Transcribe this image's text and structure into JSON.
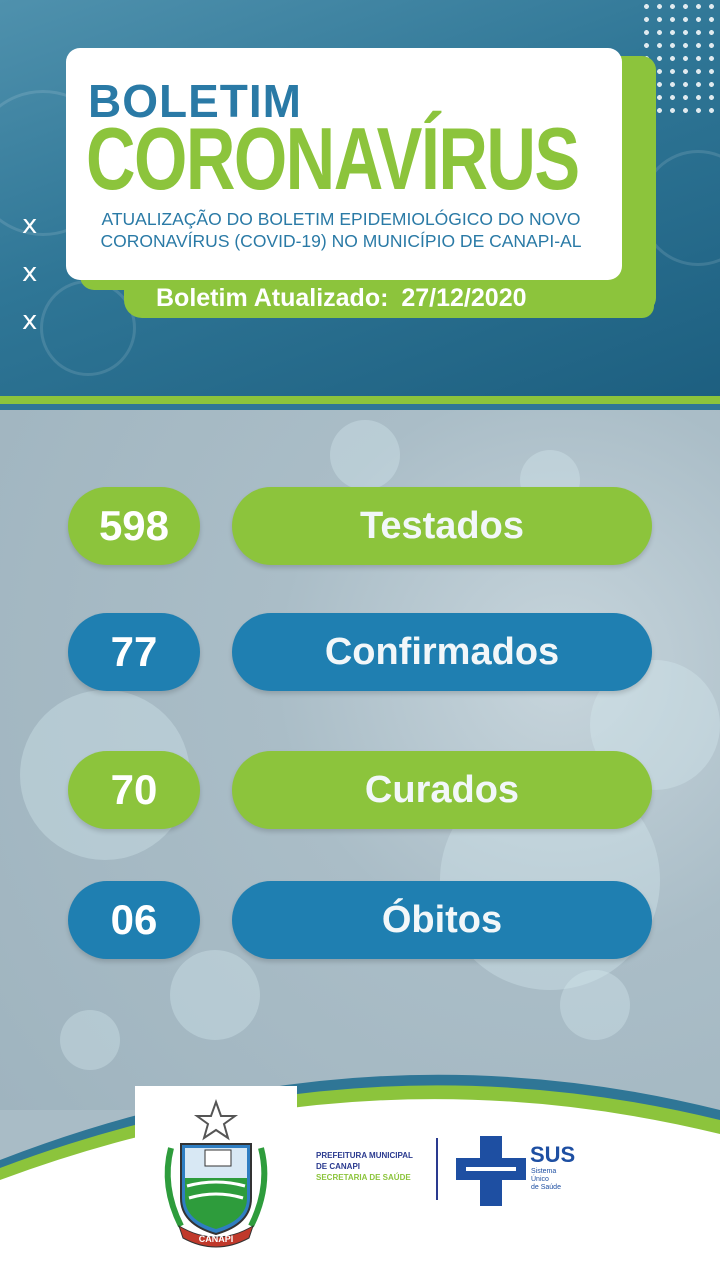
{
  "header": {
    "title_line1": "BOLETIM",
    "title_line2": "CORONAVÍRUS",
    "subtitle_line1": "ATUALIZAÇÃO DO BOLETIM EPIDEMIOLÓGICO DO NOVO",
    "subtitle_line2": "CORONAVÍRUS (COVID-19) NO MUNICÍPIO DE CANAPI-AL",
    "updated_label": "Boletim Atualizado:",
    "updated_date": "27/12/2020",
    "side_marks": [
      "x",
      "x",
      "x"
    ]
  },
  "stats": [
    {
      "value": "598",
      "label": "Testados",
      "color": "green"
    },
    {
      "value": "77",
      "label": "Confirmados",
      "color": "blue"
    },
    {
      "value": "70",
      "label": "Curados",
      "color": "green"
    },
    {
      "value": "06",
      "label": "Óbitos",
      "color": "blue"
    }
  ],
  "footer": {
    "crest_text": "CANAPI",
    "prefeitura_line1": "PREFEITURA MUNICIPAL",
    "prefeitura_line2": "DE CANAPI",
    "secretaria": "SECRETARIA DE SAÚDE",
    "sus_title": "SUS",
    "sus_sub_1": "Sistema",
    "sus_sub_2": "Único",
    "sus_sub_3": "de Saúde"
  },
  "colors": {
    "green": "#8cc43c",
    "blue": "#1f7fb1",
    "header_blue": "#2f7696",
    "title_blue": "#2a7aa6"
  }
}
